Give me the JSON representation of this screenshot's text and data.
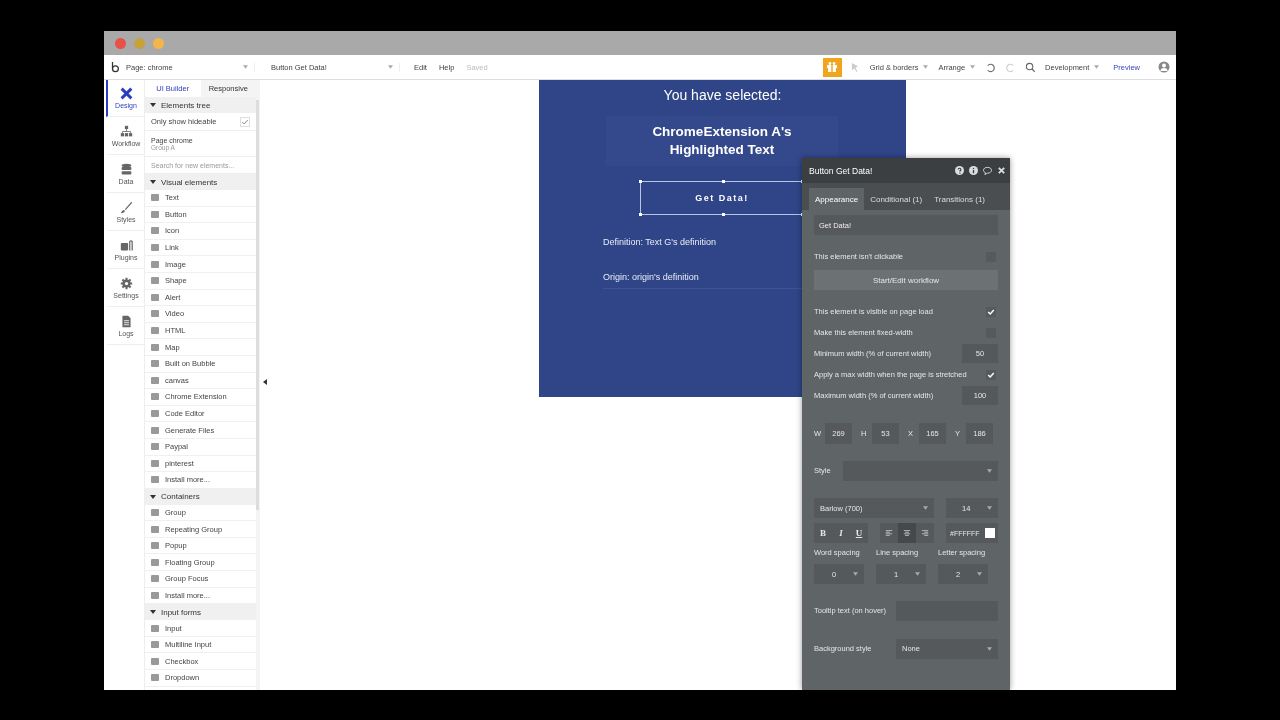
{
  "toolbar": {
    "page_select": "Page: chrome",
    "element_select": "Button Get Data!",
    "menu": [
      "Edit",
      "Help"
    ],
    "status": "Saved",
    "grid": "Grid & borders",
    "arrange": "Arrange",
    "environment": "Development",
    "preview": "Preview"
  },
  "nav": [
    {
      "label": "Design",
      "selected": true
    },
    {
      "label": "Workflow",
      "selected": false
    },
    {
      "label": "Data",
      "selected": false
    },
    {
      "label": "Styles",
      "selected": false
    },
    {
      "label": "Plugins",
      "selected": false
    },
    {
      "label": "Settings",
      "selected": false
    },
    {
      "label": "Logs",
      "selected": false
    }
  ],
  "sidebar": {
    "tabs": [
      {
        "label": "UI Builder",
        "selected": true
      },
      {
        "label": "Responsive",
        "selected": false
      }
    ],
    "tree_header": "Elements tree",
    "only_hideable": {
      "label": "Only show hideable",
      "checked": true
    },
    "page_label": "Page chrome",
    "group_label": "Group A",
    "search": {
      "placeholder": "Search for new elements..."
    },
    "sections": [
      {
        "title": "Visual elements",
        "expanded": true,
        "items": [
          "Text",
          "Button",
          "Icon",
          "Link",
          "Image",
          "Shape",
          "Alert",
          "Video",
          "HTML",
          "Map",
          "Built on Bubble",
          "canvas",
          "Chrome Extension",
          "Code Editor",
          "Generate Files",
          "Paypal",
          "pinterest",
          "Install more..."
        ]
      },
      {
        "title": "Containers",
        "expanded": true,
        "items": [
          "Group",
          "Repeating Group",
          "Popup",
          "Floating Group",
          "Group Focus",
          "Install more..."
        ]
      },
      {
        "title": "Input forms",
        "expanded": true,
        "items": [
          "Input",
          "Multiline Input",
          "Checkbox",
          "Dropdown"
        ]
      }
    ]
  },
  "canvas": {
    "heading": "You have selected:",
    "highlight": "ChromeExtension A's Highlighted Text",
    "button": {
      "label": "Get Data!",
      "selected": true
    },
    "lines": [
      "Definition: Text G's definition",
      "Origin: origin's definition"
    ]
  },
  "properties": {
    "title": "Button Get Data!",
    "tabs": [
      {
        "label": "Appearance",
        "selected": true
      },
      {
        "label": "Conditional (1)",
        "selected": false
      },
      {
        "label": "Transitions (1)",
        "selected": false
      }
    ],
    "text_value": "Get Data!",
    "rows": [
      {
        "kind": "checkbox",
        "label": "This element isn't clickable",
        "checked": false
      },
      {
        "kind": "button",
        "label": "Start/Edit workflow"
      },
      {
        "kind": "checkbox",
        "label": "This element is visible on page load",
        "checked": true
      },
      {
        "kind": "checkbox",
        "label": "Make this element fixed-width",
        "checked": false
      },
      {
        "kind": "number",
        "label": "Minimum width (% of current width)",
        "value": "50"
      },
      {
        "kind": "checkbox",
        "label": "Apply a max width when the page is stretched",
        "checked": true
      },
      {
        "kind": "number",
        "label": "Maximum width (% of current width)",
        "value": "100"
      }
    ],
    "geometry": [
      {
        "label": "W",
        "value": "269"
      },
      {
        "label": "H",
        "value": "53"
      },
      {
        "label": "X",
        "value": "165"
      },
      {
        "label": "Y",
        "value": "186"
      }
    ],
    "style_label": "Style",
    "font": "Barlow (700)",
    "font_size": "14",
    "format": [
      "B",
      "I",
      "U"
    ],
    "alignment": [
      {
        "selected": false
      },
      {
        "selected": true
      },
      {
        "selected": false
      }
    ],
    "text_color": {
      "value": "#FFFFFF",
      "color": "#ffffff"
    },
    "spacing": [
      {
        "label": "Word spacing",
        "value": "0"
      },
      {
        "label": "Line spacing",
        "value": "1"
      },
      {
        "label": "Letter spacing",
        "value": "2"
      }
    ],
    "tooltip_label": "Tooltip text (on hover)",
    "background": {
      "label": "Background style",
      "value": "None"
    }
  }
}
